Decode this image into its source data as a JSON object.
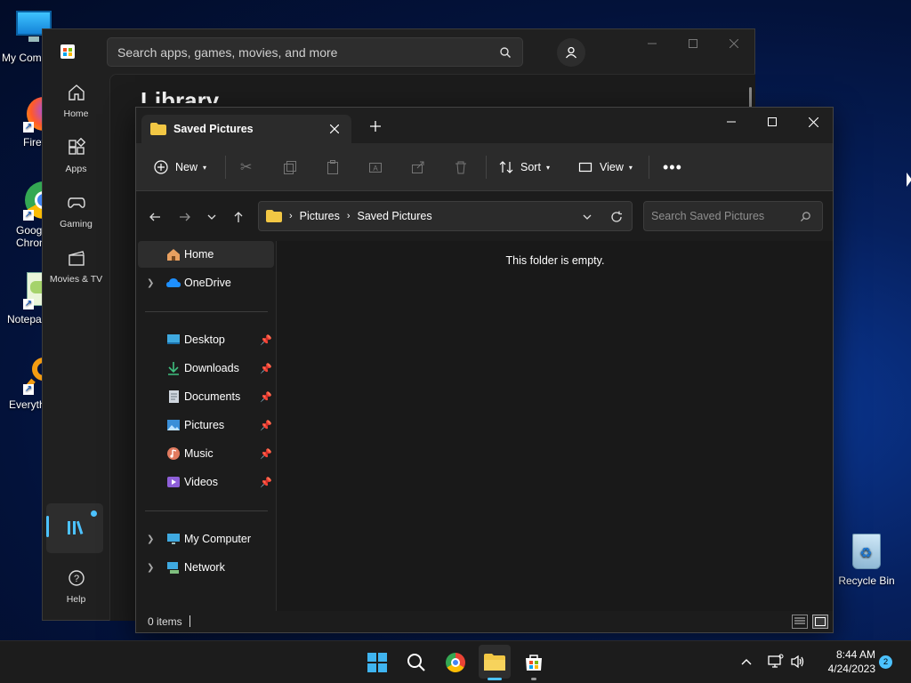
{
  "desktop": {
    "icons": [
      {
        "label": "My Com",
        "name": "my-computer"
      },
      {
        "label": "Firefo",
        "name": "firefox"
      },
      {
        "label": "Goog\nChron",
        "name": "google-chrome"
      },
      {
        "label": "Notepa",
        "name": "notepad"
      },
      {
        "label": "Everyth",
        "name": "everything"
      }
    ],
    "recycle_bin": "Recycle Bin"
  },
  "store": {
    "search_placeholder": "Search apps, games, movies, and more",
    "heading_partial": "Library",
    "nav": [
      {
        "label": "Home"
      },
      {
        "label": "Apps"
      },
      {
        "label": "Gaming"
      },
      {
        "label": "Movies & TV"
      }
    ],
    "help": "Help"
  },
  "explorer": {
    "tab_title": "Saved Pictures",
    "toolbar": {
      "new": "New",
      "sort": "Sort",
      "view": "View"
    },
    "breadcrumb": [
      "Pictures",
      "Saved Pictures"
    ],
    "search_placeholder": "Search Saved Pictures",
    "empty_message": "This folder is empty.",
    "nav": {
      "home": "Home",
      "onedrive": "OneDrive",
      "quick": [
        {
          "label": "Desktop"
        },
        {
          "label": "Downloads"
        },
        {
          "label": "Documents"
        },
        {
          "label": "Pictures"
        },
        {
          "label": "Music"
        },
        {
          "label": "Videos"
        }
      ],
      "my_computer": "My Computer",
      "network": "Network"
    },
    "status": "0 items"
  },
  "taskbar": {
    "time": "8:44 AM",
    "date": "4/24/2023",
    "notification_count": "2"
  },
  "colors": {
    "accent": "#4cc2ff",
    "folder": "#f2c744",
    "desktop_bg": "#06205e"
  }
}
